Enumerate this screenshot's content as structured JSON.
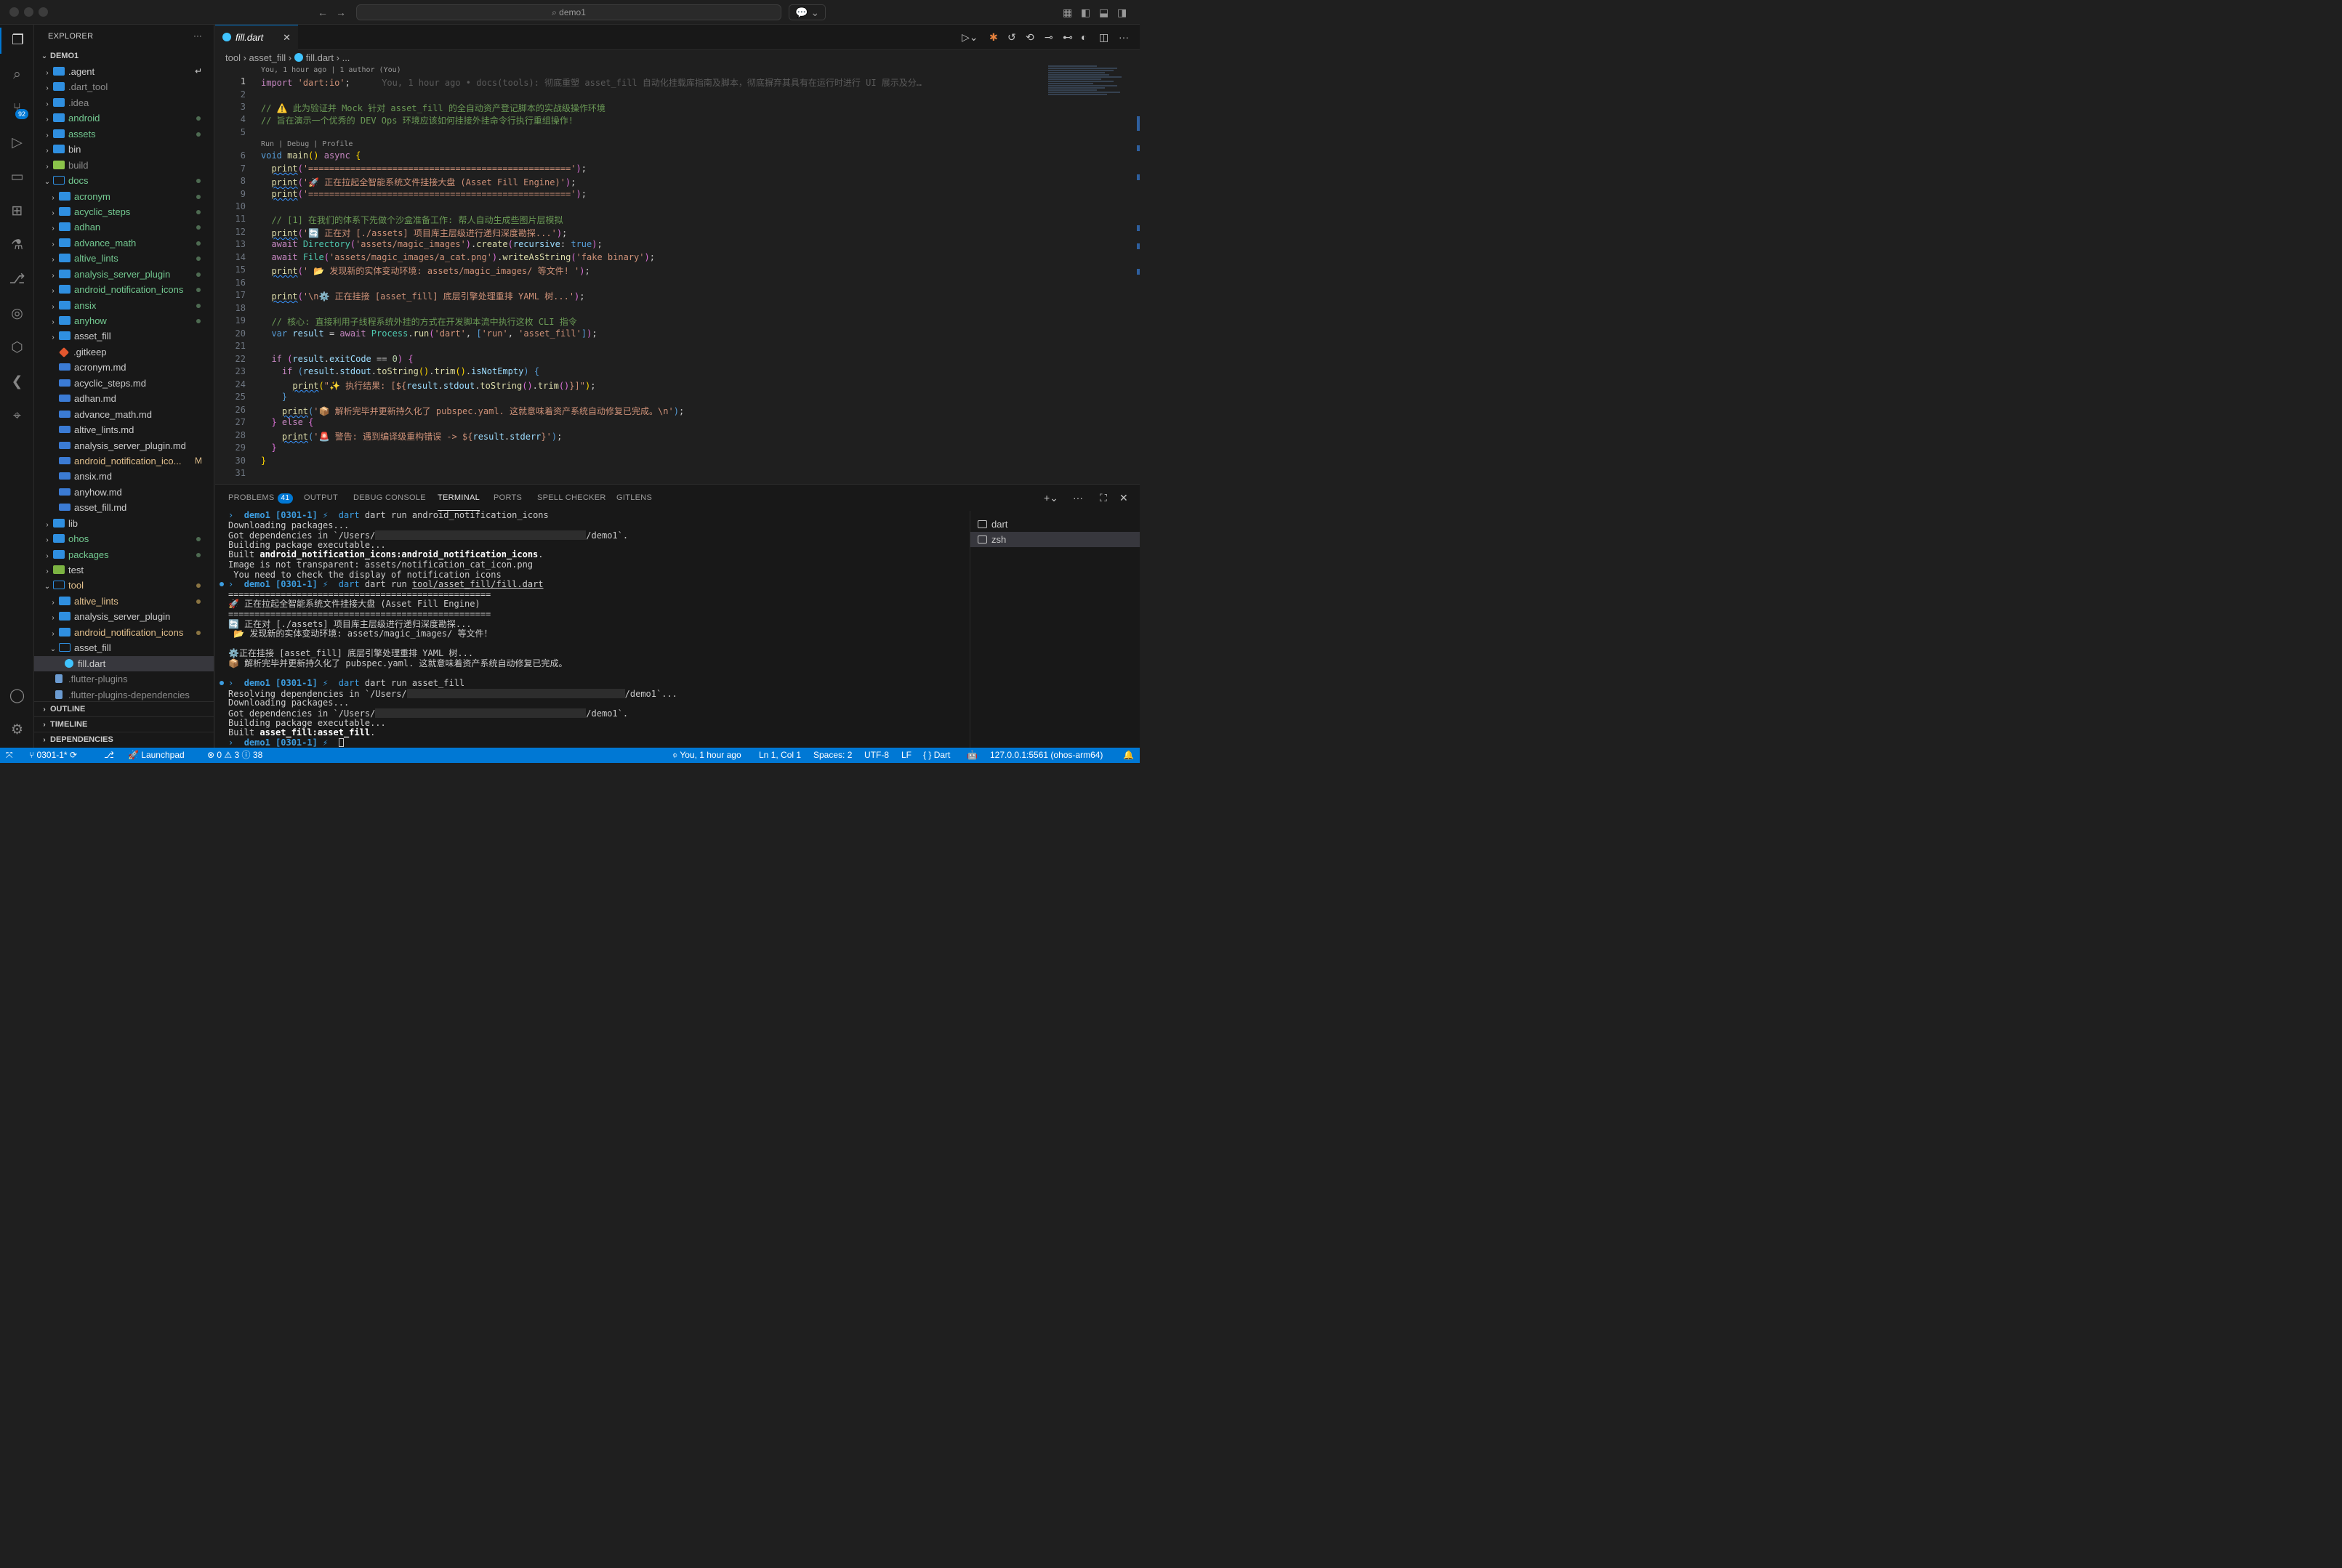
{
  "titlebar": {
    "search_text": "demo1"
  },
  "activity": {
    "scm_badge": "92"
  },
  "explorer": {
    "header": "EXPLORER",
    "more": "···",
    "root": "DEMO1",
    "items": [
      {
        "label": ".agent",
        "depth": 0,
        "kind": "folder",
        "color": "default",
        "mark": "↵"
      },
      {
        "label": ".dart_tool",
        "depth": 0,
        "kind": "folder",
        "color": "gray"
      },
      {
        "label": ".idea",
        "depth": 0,
        "kind": "folder",
        "color": "gray"
      },
      {
        "label": "android",
        "depth": 0,
        "kind": "folder",
        "color": "green",
        "dot": "green"
      },
      {
        "label": "assets",
        "depth": 0,
        "kind": "folder",
        "color": "green",
        "dot": "green"
      },
      {
        "label": "bin",
        "depth": 0,
        "kind": "folder",
        "color": "default"
      },
      {
        "label": "build",
        "depth": 0,
        "kind": "build",
        "color": "gray"
      },
      {
        "label": "docs",
        "depth": 0,
        "kind": "folder-open",
        "open": true,
        "color": "green",
        "dot": "green"
      },
      {
        "label": "acronym",
        "depth": 1,
        "kind": "folder",
        "color": "green",
        "dot": "green"
      },
      {
        "label": "acyclic_steps",
        "depth": 1,
        "kind": "folder",
        "color": "green",
        "dot": "green"
      },
      {
        "label": "adhan",
        "depth": 1,
        "kind": "folder",
        "color": "green",
        "dot": "green"
      },
      {
        "label": "advance_math",
        "depth": 1,
        "kind": "folder",
        "color": "green",
        "dot": "green"
      },
      {
        "label": "altive_lints",
        "depth": 1,
        "kind": "folder",
        "color": "green",
        "dot": "green"
      },
      {
        "label": "analysis_server_plugin",
        "depth": 1,
        "kind": "folder",
        "color": "green",
        "dot": "green"
      },
      {
        "label": "android_notification_icons",
        "depth": 1,
        "kind": "folder",
        "color": "green",
        "dot": "green"
      },
      {
        "label": "ansix",
        "depth": 1,
        "kind": "folder",
        "color": "green",
        "dot": "green"
      },
      {
        "label": "anyhow",
        "depth": 1,
        "kind": "folder",
        "color": "green",
        "dot": "green"
      },
      {
        "label": "asset_fill",
        "depth": 1,
        "kind": "folder",
        "color": "default"
      },
      {
        "label": ".gitkeep",
        "depth": 1,
        "kind": "git",
        "leaf": true,
        "color": "default"
      },
      {
        "label": "acronym.md",
        "depth": 1,
        "kind": "md",
        "leaf": true,
        "color": "default"
      },
      {
        "label": "acyclic_steps.md",
        "depth": 1,
        "kind": "md",
        "leaf": true,
        "color": "default"
      },
      {
        "label": "adhan.md",
        "depth": 1,
        "kind": "md",
        "leaf": true,
        "color": "default"
      },
      {
        "label": "advance_math.md",
        "depth": 1,
        "kind": "md",
        "leaf": true,
        "color": "default"
      },
      {
        "label": "altive_lints.md",
        "depth": 1,
        "kind": "md",
        "leaf": true,
        "color": "default"
      },
      {
        "label": "analysis_server_plugin.md",
        "depth": 1,
        "kind": "md",
        "leaf": true,
        "color": "default"
      },
      {
        "label": "android_notification_ico...",
        "depth": 1,
        "kind": "md",
        "leaf": true,
        "color": "yellow",
        "mark": "M"
      },
      {
        "label": "ansix.md",
        "depth": 1,
        "kind": "md",
        "leaf": true,
        "color": "default"
      },
      {
        "label": "anyhow.md",
        "depth": 1,
        "kind": "md",
        "leaf": true,
        "color": "default"
      },
      {
        "label": "asset_fill.md",
        "depth": 1,
        "kind": "md",
        "leaf": true,
        "color": "default"
      },
      {
        "label": "lib",
        "depth": 0,
        "kind": "folder",
        "color": "default"
      },
      {
        "label": "ohos",
        "depth": 0,
        "kind": "folder",
        "color": "green",
        "dot": "green"
      },
      {
        "label": "packages",
        "depth": 0,
        "kind": "folder",
        "color": "green",
        "dot": "green"
      },
      {
        "label": "test",
        "depth": 0,
        "kind": "test",
        "color": "default"
      },
      {
        "label": "tool",
        "depth": 0,
        "kind": "folder-open",
        "open": true,
        "color": "yellow",
        "dot": "yellow"
      },
      {
        "label": "altive_lints",
        "depth": 1,
        "kind": "folder",
        "color": "yellow",
        "dot": "yellow"
      },
      {
        "label": "analysis_server_plugin",
        "depth": 1,
        "kind": "folder",
        "color": "default"
      },
      {
        "label": "android_notification_icons",
        "depth": 1,
        "kind": "folder",
        "color": "yellow",
        "dot": "yellow"
      },
      {
        "label": "asset_fill",
        "depth": 1,
        "kind": "folder-open",
        "open": true,
        "color": "default"
      },
      {
        "label": "fill.dart",
        "depth": 2,
        "kind": "dart",
        "leaf": true,
        "color": "default",
        "selected": true
      },
      {
        "label": ".flutter-plugins",
        "depth": 0,
        "kind": "file",
        "leaf": true,
        "color": "gray"
      },
      {
        "label": ".flutter-plugins-dependencies",
        "depth": 0,
        "kind": "file",
        "leaf": true,
        "color": "gray"
      }
    ],
    "sections": [
      "OUTLINE",
      "TIMELINE",
      "DEPENDENCIES"
    ]
  },
  "editor": {
    "tab_label": "fill.dart",
    "breadcrumb": [
      "tool",
      "asset_fill",
      "fill.dart",
      "..."
    ],
    "codelens_blame": "You, 1 hour ago | 1 author (You)",
    "codelens_run": "Run | Debug | Profile",
    "inline_blame": "You, 1 hour ago • docs(tools): 彻底重塑 asset_fill 自动化挂载库指南及脚本，彻底摒弃其具有在运行时进行 UI 展示及分…",
    "line_numbers": [
      "1",
      "2",
      "3",
      "4",
      "5",
      "6",
      "7",
      "8",
      "9",
      "10",
      "11",
      "12",
      "13",
      "14",
      "15",
      "16",
      "17",
      "18",
      "19",
      "20",
      "21",
      "22",
      "23",
      "24",
      "25",
      "26",
      "27",
      "28",
      "29",
      "30",
      "31"
    ]
  },
  "panel": {
    "tabs": [
      "PROBLEMS",
      "OUTPUT",
      "DEBUG CONSOLE",
      "TERMINAL",
      "PORTS",
      "SPELL CHECKER",
      "GITLENS"
    ],
    "problems_count": "41",
    "terminal_list": [
      "dart",
      "zsh"
    ]
  },
  "terminal": {
    "prompt": "demo1 [0301-1] ⚡",
    "lines": {
      "c1": "dart run android_notification_icons",
      "l2": "Downloading packages...",
      "l3a": "Got dependencies in `/Users/",
      "l3b": "/demo1`.",
      "l4": "Building package executable...",
      "l5a": "Built ",
      "l5b": "android_notification_icons:android_notification_icons",
      "l5c": ".",
      "l6": "Image is not transparent: assets/notification_cat_icon.png",
      "l7": " You need to check the display of notification icons",
      "c2a": "dart run ",
      "c2b": "tool/asset_fill/fill.dart",
      "sep": "==================================================",
      "o1": "🚀 正在拉起全智能系统文件挂接大盘 (Asset Fill Engine)",
      "o2": "🔄 正在对 [./assets] 项目库主层级进行递归深度勘探...",
      "o3": " 📂 发现新的实体变动环境: assets/magic_images/ 等文件！",
      "o4": "⚙️正在挂接 [asset_fill] 底层引擎处理重排 YAML 树...",
      "o5": "📦 解析完毕并更新持久化了 pubspec.yaml. 这就意味着资产系统自动修复已完成。",
      "c3": "dart run asset_fill",
      "r1a": "Resolving dependencies in `/Users/",
      "r1b": "/demo1`...",
      "r2": "Downloading packages...",
      "r3a": "Got dependencies in `/Users/",
      "r3b": "/demo1`.",
      "r4": "Building package executable...",
      "r5a": "Built ",
      "r5b": "asset_fill:asset_fill",
      "r5c": "."
    }
  },
  "statusbar": {
    "branch": "0301-1*",
    "launchpad": "Launchpad",
    "errors": "0",
    "warnings": "3",
    "infos": "38",
    "blame": "You, 1 hour ago",
    "position": "Ln 1, Col 1",
    "spaces": "Spaces: 2",
    "encoding": "UTF-8",
    "eol": "LF",
    "language": "Dart",
    "device": "127.0.0.1:5561 (ohos-arm64)"
  },
  "colors": {
    "accent": "#0078d4",
    "statusbar": "#0078d4",
    "git_added": "#73c991",
    "git_modified": "#e2c08d"
  }
}
